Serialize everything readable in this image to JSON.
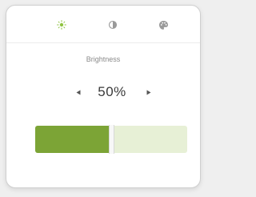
{
  "tabs": [
    {
      "icon": "sun-icon",
      "color": "#8fc341"
    },
    {
      "icon": "contrast-icon",
      "color": "#9a9a9a"
    },
    {
      "icon": "palette-icon",
      "color": "#9a9a9a"
    }
  ],
  "setting": {
    "label": "Brightness",
    "value_text": "50%",
    "value": 0.5
  },
  "colors": {
    "accent": "#7ca436",
    "track": "#e7f0d6"
  }
}
